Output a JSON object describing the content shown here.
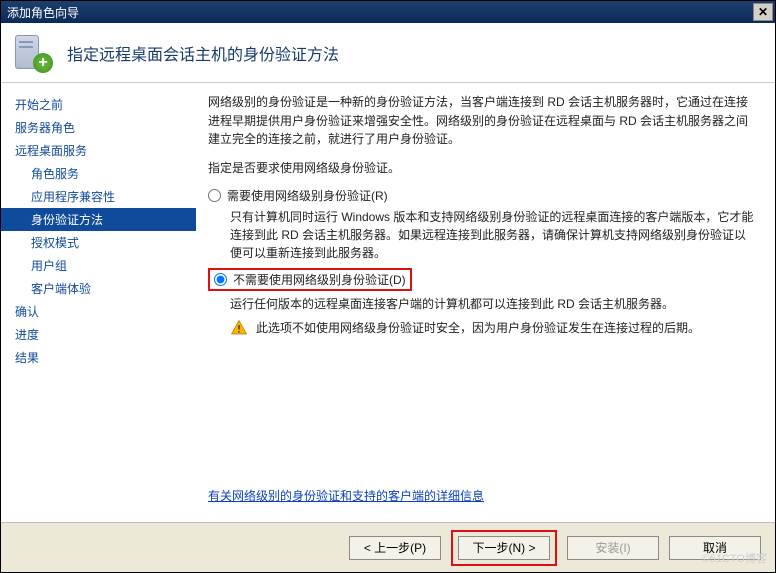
{
  "window": {
    "title": "添加角色向导"
  },
  "header": {
    "title": "指定远程桌面会话主机的身份验证方法"
  },
  "sidebar": {
    "items": [
      {
        "label": "开始之前",
        "child": false,
        "selected": false
      },
      {
        "label": "服务器角色",
        "child": false,
        "selected": false
      },
      {
        "label": "远程桌面服务",
        "child": false,
        "selected": false
      },
      {
        "label": "角色服务",
        "child": true,
        "selected": false
      },
      {
        "label": "应用程序兼容性",
        "child": true,
        "selected": false
      },
      {
        "label": "身份验证方法",
        "child": true,
        "selected": true
      },
      {
        "label": "授权模式",
        "child": true,
        "selected": false
      },
      {
        "label": "用户组",
        "child": true,
        "selected": false
      },
      {
        "label": "客户端体验",
        "child": true,
        "selected": false
      },
      {
        "label": "确认",
        "child": false,
        "selected": false
      },
      {
        "label": "进度",
        "child": false,
        "selected": false
      },
      {
        "label": "结果",
        "child": false,
        "selected": false
      }
    ]
  },
  "content": {
    "intro": "网络级别的身份验证是一种新的身份验证方法，当客户端连接到 RD 会话主机服务器时，它通过在连接进程早期提供用户身份验证来增强安全性。网络级别的身份验证在远程桌面与 RD 会话主机服务器之间建立完全的连接之前，就进行了用户身份验证。",
    "prompt": "指定是否要求使用网络级身份验证。",
    "opt1_label": "需要使用网络级别身份验证(R)",
    "opt1_desc": "只有计算机同时运行 Windows 版本和支持网络级别身份验证的远程桌面连接的客户端版本，它才能连接到此 RD 会话主机服务器。如果远程连接到此服务器，请确保计算机支持网络级别身份验证以便可以重新连接到此服务器。",
    "opt2_label": "不需要使用网络级别身份验证(D)",
    "opt2_desc": "运行任何版本的远程桌面连接客户端的计算机都可以连接到此 RD 会话主机服务器。",
    "warn": "此选项不如使用网络级身份验证时安全，因为用户身份验证发生在连接过程的后期。",
    "link": "有关网络级别的身份验证和支持的客户端的详细信息"
  },
  "buttons": {
    "prev": "< 上一步(P)",
    "next": "下一步(N) >",
    "install": "安装(I)",
    "cancel": "取消"
  },
  "watermark": "©51CTO博客"
}
